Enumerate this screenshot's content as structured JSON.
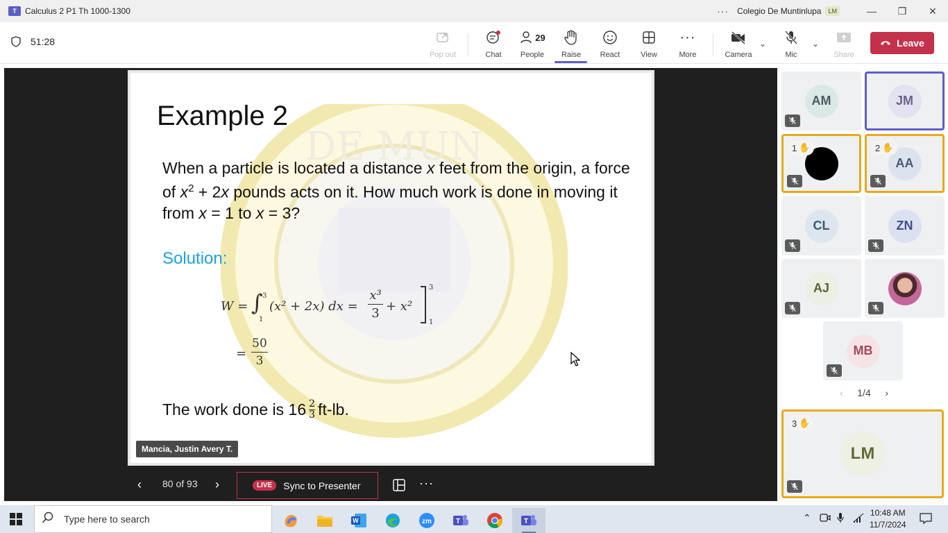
{
  "titlebar": {
    "title": "Calculus 2 P1 Th 1000-1300",
    "more": "···",
    "org": "Colegio De Muntinlupa",
    "org_badge": "LM",
    "minimize": "—",
    "restore": "❐",
    "close": "✕"
  },
  "toolbar": {
    "timer": "51:28",
    "popout_label": "Pop out",
    "chat_label": "Chat",
    "people_label": "People",
    "people_count": "29",
    "raise_label": "Raise",
    "react_label": "React",
    "view_label": "View",
    "more_label": "More",
    "camera_label": "Camera",
    "mic_label": "Mic",
    "share_label": "Share",
    "leave_label": "Leave"
  },
  "slide": {
    "title": "Example 2",
    "problem_1": "When a particle is located a distance ",
    "problem_x1": "x",
    "problem_2": " feet from the origin, a force of ",
    "problem_x2": "x",
    "problem_sup": "2",
    "problem_3": " + 2",
    "problem_x3": "x",
    "problem_4": " pounds acts on it. How much work is done in moving it from ",
    "problem_x4": "x",
    "problem_5": " = 1 to ",
    "problem_x5": "x",
    "problem_6": " = 3?",
    "solution_label": "Solution:",
    "eq_lhs": "W = ",
    "eq_int_upper": "3",
    "eq_int_lower": "1",
    "eq_integrand": "(x² + 2x) dx = ",
    "eq_frac_num": "x³",
    "eq_frac_den": "3",
    "eq_plus": " + x²",
    "eq_eval_upper": "3",
    "eq_eval_lower": "1",
    "eq2_eq": "=",
    "eq2_num": "50",
    "eq2_den": "3",
    "answer_1": "The work done is 16",
    "answer_frac_num": "2",
    "answer_frac_den": "3",
    "answer_2": "ft-lb."
  },
  "presenter_name": "Mancia, Justin Avery T.",
  "slide_controls": {
    "prev": "‹",
    "count": "80 of 93",
    "next": "›",
    "live": "LIVE",
    "sync": "Sync to Presenter",
    "more": "···"
  },
  "participants": [
    {
      "initials": "AM",
      "bg": "#dbe9e6",
      "fg": "#4a5a66",
      "muted": true
    },
    {
      "initials": "JM",
      "bg": "#e4e2f0",
      "fg": "#6a6390",
      "muted": false,
      "speaking": true
    },
    {
      "initials": "",
      "bg": "#000000",
      "fg": "#000000",
      "muted": true,
      "hand": "1"
    },
    {
      "initials": "AA",
      "bg": "#dde3ee",
      "fg": "#4a5a78",
      "muted": true,
      "hand": "2"
    },
    {
      "initials": "CL",
      "bg": "#dde6ee",
      "fg": "#3d5a73",
      "muted": true
    },
    {
      "initials": "ZN",
      "bg": "#dce1f1",
      "fg": "#3f4e86",
      "muted": true
    },
    {
      "initials": "AJ",
      "bg": "#ecefe3",
      "fg": "#58653b",
      "muted": true
    },
    {
      "initials": "",
      "bg": "#b56a8a",
      "fg": "#ffffff",
      "muted": true,
      "photo": true
    },
    {
      "initials": "MB",
      "bg": "#f6e3e6",
      "fg": "#a24a5a",
      "muted": true
    },
    {
      "initials": "LM",
      "bg": "#eef0e4",
      "fg": "#5f6a3b",
      "muted": true,
      "hand": "3"
    }
  ],
  "gallery_pager": {
    "prev": "‹",
    "label": "1/4",
    "next": "›"
  },
  "hand_glyph": "✋",
  "taskbar": {
    "search_placeholder": "Type here to search",
    "time": "10:48 AM",
    "date": "11/7/2024",
    "apps": [
      "copilot-icon",
      "file-explorer-icon",
      "word-icon",
      "edge-icon",
      "zoom-icon",
      "teams-icon",
      "chrome-icon",
      "teams-active-icon"
    ]
  }
}
